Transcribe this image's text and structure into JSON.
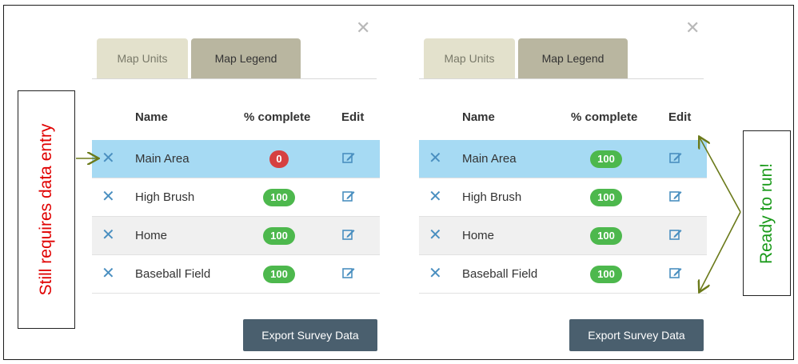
{
  "panels": [
    {
      "close_icon": "✕",
      "tabs": [
        "Map Units",
        "Map Legend"
      ],
      "headers": {
        "name": "Name",
        "pct": "% complete",
        "edit": "Edit"
      },
      "rows": [
        {
          "name": "Main Area",
          "pct": "0",
          "status": "red",
          "selected": true
        },
        {
          "name": "High Brush",
          "pct": "100",
          "status": "green",
          "selected": false
        },
        {
          "name": "Home",
          "pct": "100",
          "status": "green",
          "selected": false
        },
        {
          "name": "Baseball Field",
          "pct": "100",
          "status": "green",
          "selected": false
        }
      ],
      "export_label": "Export Survey Data"
    },
    {
      "close_icon": "✕",
      "tabs": [
        "Map Units",
        "Map Legend"
      ],
      "headers": {
        "name": "Name",
        "pct": "% complete",
        "edit": "Edit"
      },
      "rows": [
        {
          "name": "Main Area",
          "pct": "100",
          "status": "green",
          "selected": true
        },
        {
          "name": "High Brush",
          "pct": "100",
          "status": "green",
          "selected": false
        },
        {
          "name": "Home",
          "pct": "100",
          "status": "green",
          "selected": false
        },
        {
          "name": "Baseball Field",
          "pct": "100",
          "status": "green",
          "selected": false
        }
      ],
      "export_label": "Export Survey Data"
    }
  ],
  "annotations": {
    "left": "Still requires data entry",
    "right": "Ready to run!"
  },
  "icons": {
    "row_delete": "✕",
    "edit": "edit-icon"
  },
  "colors": {
    "selected_row": "#a6daf3",
    "badge_green": "#4db84d",
    "badge_red": "#d64040",
    "button": "#4a5f6e",
    "tab_active": "#b9b6a0",
    "tab_inactive": "#e3e1cc",
    "annotation_left": "#e00000",
    "annotation_right": "#1a9a1a",
    "arrow": "#6b7a1a"
  }
}
